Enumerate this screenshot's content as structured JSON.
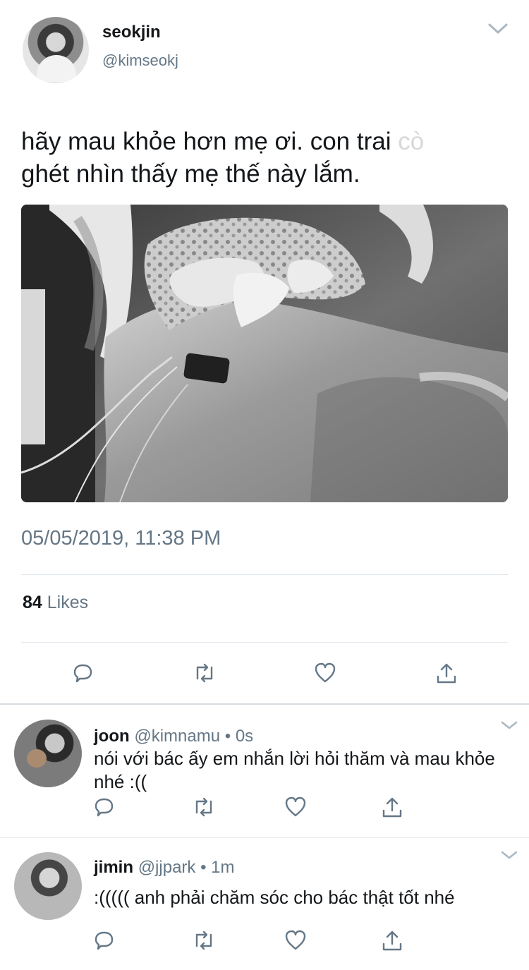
{
  "tweet": {
    "author_name": "seokjin",
    "author_handle": "@kimseokj",
    "text_main": "hãy mau khỏe hơn mẹ ơi. con trai",
    "text_faint": " cò",
    "text_second": "ghét nhìn thấy mẹ thế này lắm.",
    "timestamp": "05/05/2019, 11:38 PM",
    "likes_count": "84",
    "likes_label": " Likes",
    "photo": "grayscale hospital bed photo"
  },
  "replies": [
    {
      "name": "joon",
      "handle": "@kimnamu",
      "separator": " • ",
      "time": "0s",
      "text": "nói với bác ấy em nhắn lời hỏi thăm và mau khỏe nhé :(("
    },
    {
      "name": "jimin",
      "handle": "@jjpark",
      "separator": " • ",
      "time": "1m",
      "text": ":((((( anh phải chăm sóc cho bác thật tốt nhé"
    }
  ],
  "icons": {
    "reply": "reply-icon",
    "retweet": "retweet-icon",
    "like": "heart-icon",
    "share": "share-icon",
    "more": "chevron-down-icon"
  },
  "colors": {
    "secondary_text": "#657786",
    "divider": "#e1e8ed"
  }
}
